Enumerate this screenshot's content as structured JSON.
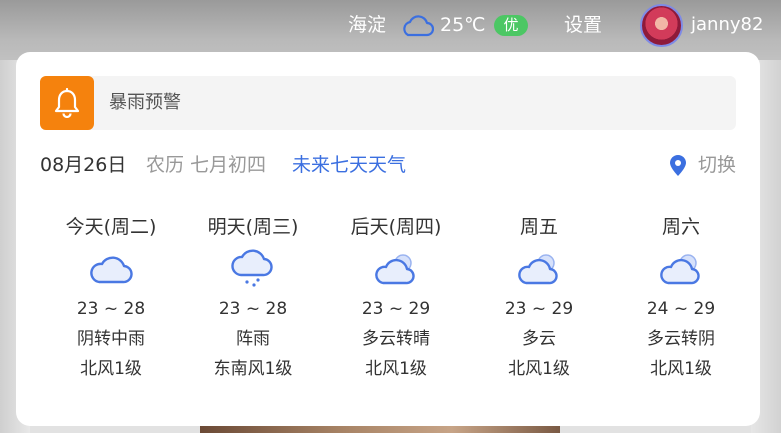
{
  "topbar": {
    "city": "海淀",
    "weather_icon": "cloud-icon",
    "temperature": "25℃",
    "aqi": "优",
    "aqi_color": "#4cc764",
    "settings": "设置",
    "username": "janny82"
  },
  "alert": {
    "icon": "bell-icon",
    "text": "暴雨预警"
  },
  "dateline": {
    "date": "08月26日",
    "lunar": "农历 七月初四",
    "forecast_link": "未来七天天气",
    "switch_label": "切换"
  },
  "days": [
    {
      "name": "今天(周二)",
      "icon": "cloudy-icon",
      "temp": "23 ~ 28",
      "cond": "阴转中雨",
      "wind": "北风1级"
    },
    {
      "name": "明天(周三)",
      "icon": "shower-icon",
      "temp": "23 ~ 28",
      "cond": "阵雨",
      "wind": "东南风1级"
    },
    {
      "name": "后天(周四)",
      "icon": "partly-cloudy-icon",
      "temp": "23 ~ 29",
      "cond": "多云转晴",
      "wind": "北风1级"
    },
    {
      "name": "周五",
      "icon": "partly-cloudy-icon",
      "temp": "23 ~ 29",
      "cond": "多云",
      "wind": "北风1级"
    },
    {
      "name": "周六",
      "icon": "partly-cloudy-icon",
      "temp": "24 ~ 29",
      "cond": "多云转阴",
      "wind": "北风1级"
    }
  ],
  "colors": {
    "accent": "#3b6fe0",
    "alert_orange": "#f5820d"
  }
}
